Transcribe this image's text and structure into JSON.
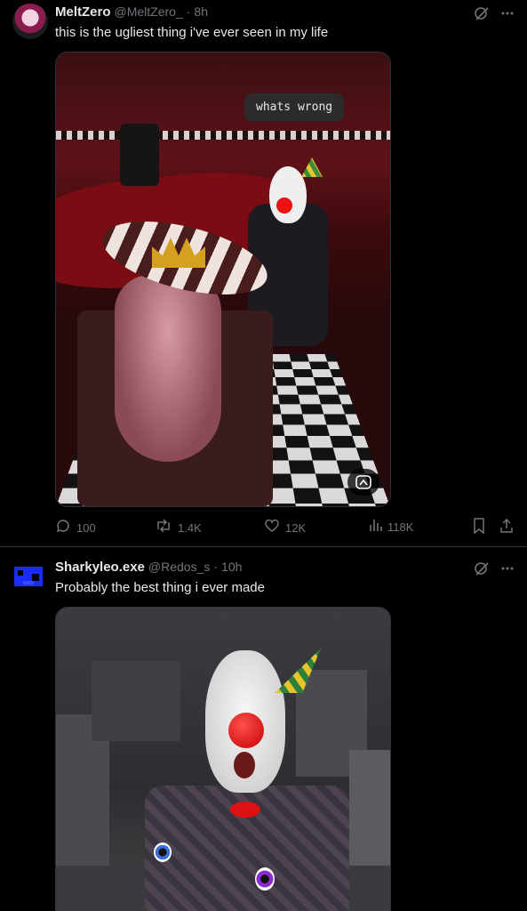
{
  "tweets": [
    {
      "author": {
        "name": "MeltZero",
        "handle": "@MeltZero_",
        "time": "8h"
      },
      "text": "this is the ugliest thing i've ever seen in my life",
      "media": {
        "speech_bubble": "whats wrong"
      },
      "stats": {
        "replies": "100",
        "reposts": "1.4K",
        "likes": "12K",
        "views": "118K"
      }
    },
    {
      "author": {
        "name": "Sharkyleo.exe",
        "handle": "@Redos_s",
        "time": "10h"
      },
      "text": "Probably the best thing i ever made"
    }
  ],
  "separator": "·",
  "icons": {
    "grok": "grok-icon",
    "more": "more-icon",
    "reply": "reply-icon",
    "repost": "repost-icon",
    "like": "heart-icon",
    "views": "views-icon",
    "bookmark": "bookmark-icon",
    "share": "share-icon",
    "alt": "alt-image-icon"
  },
  "colors": {
    "background": "#000000",
    "muted": "#71767b",
    "text": "#e7e9ea",
    "divider": "#2f3336"
  }
}
